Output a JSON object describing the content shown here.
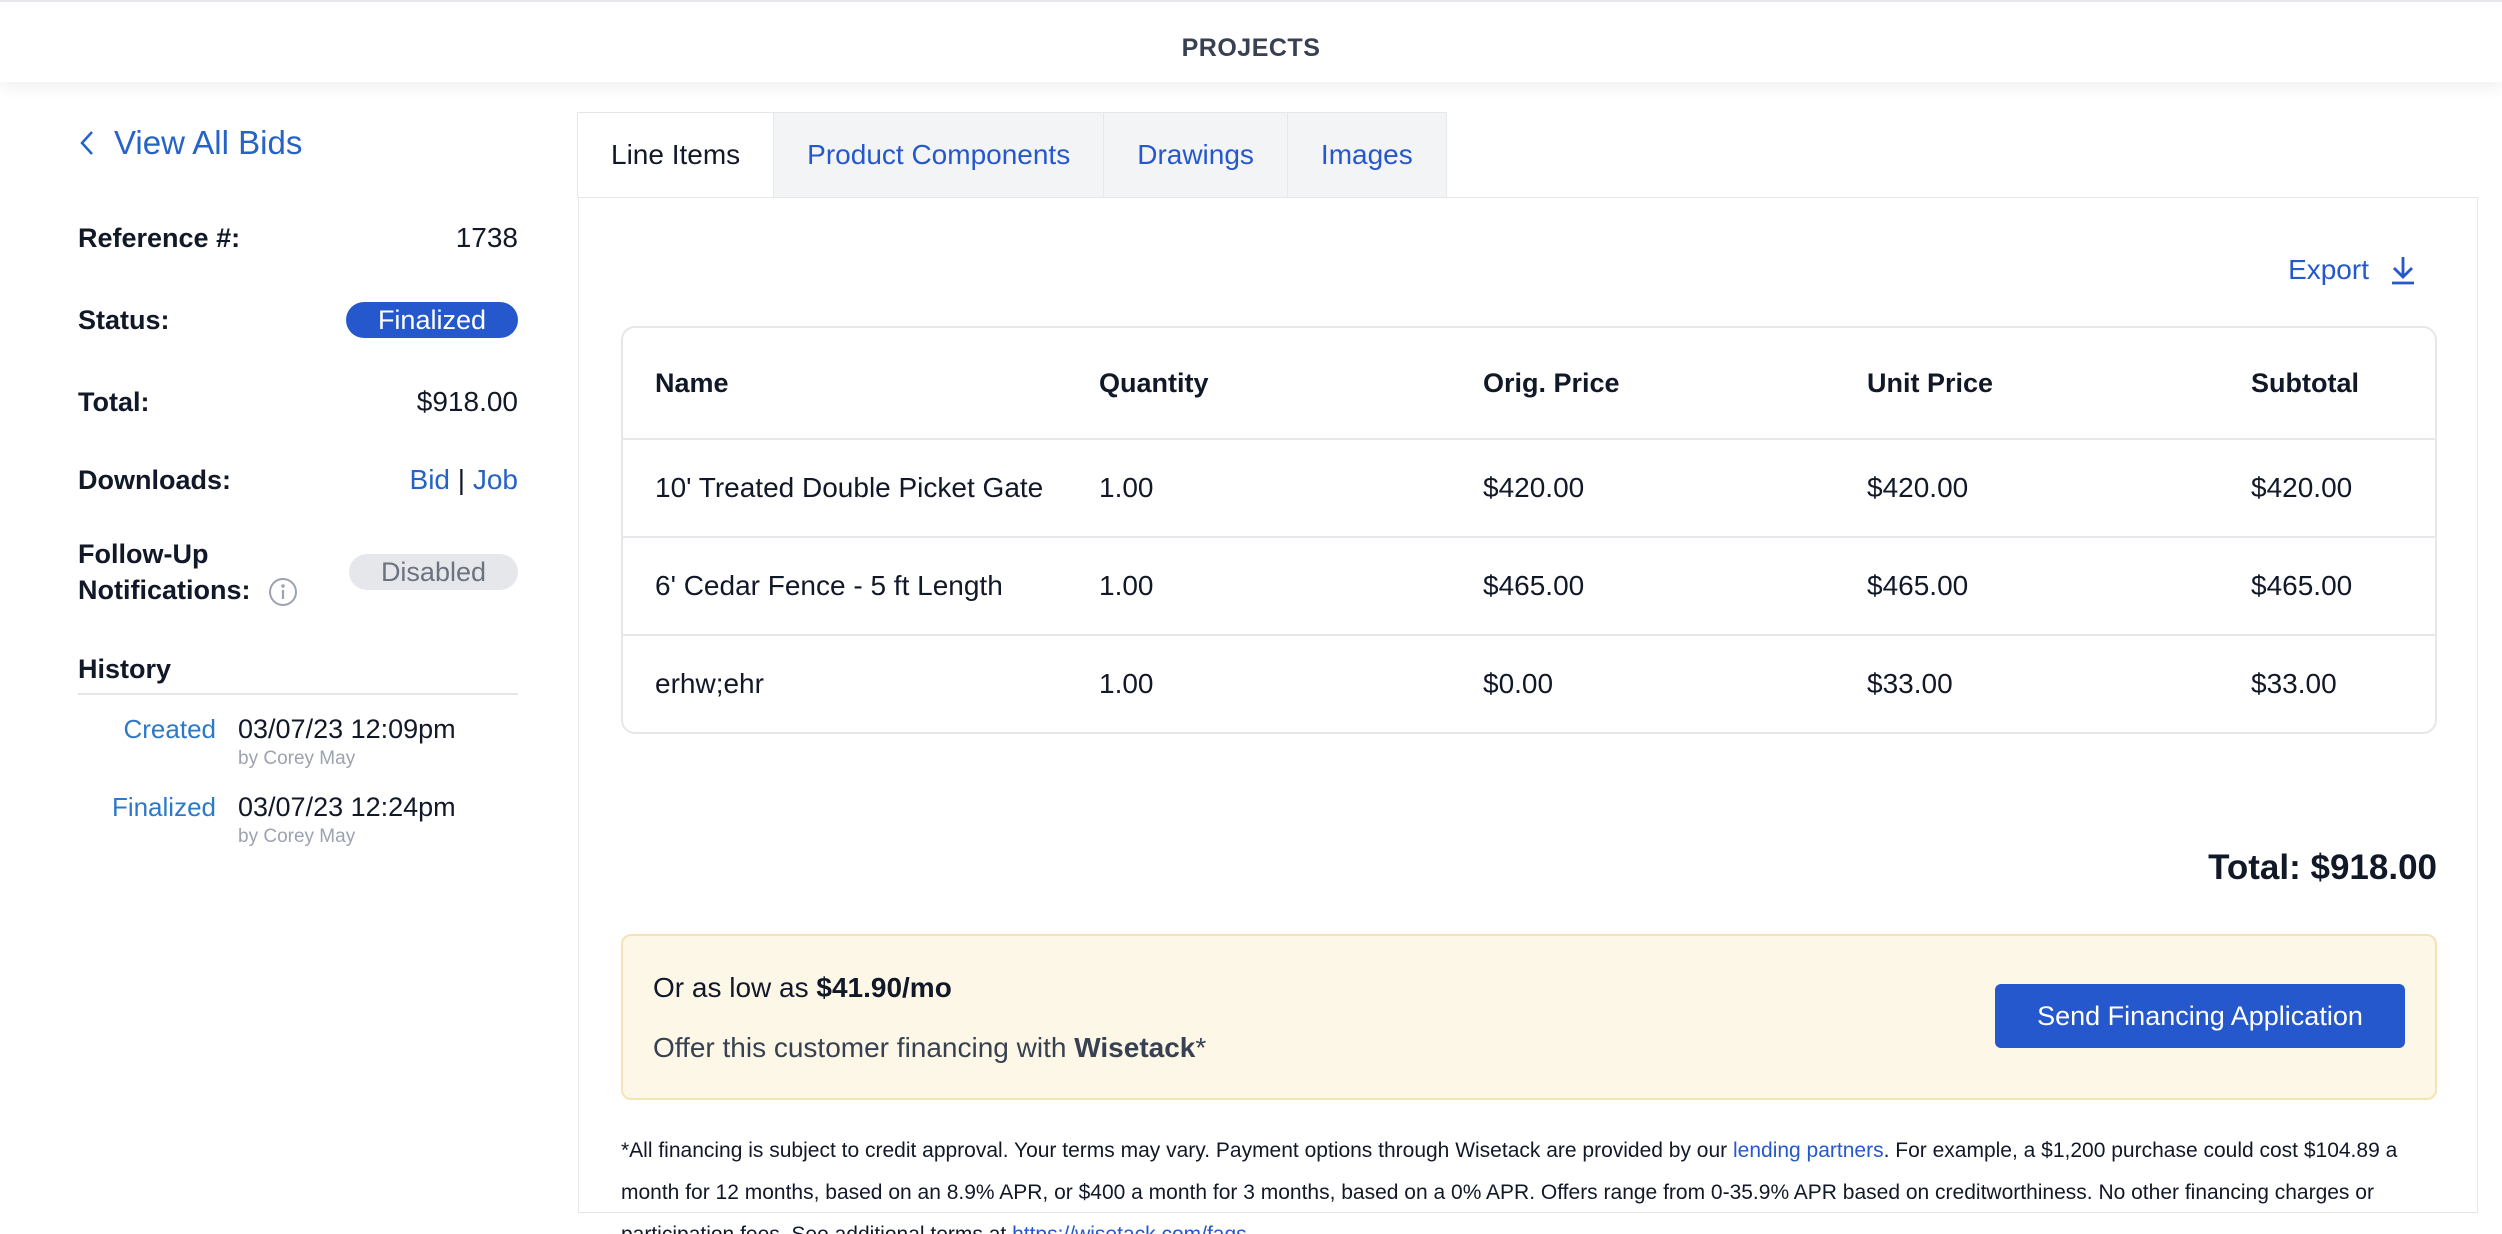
{
  "header": {
    "title": "PROJECTS"
  },
  "sidebar": {
    "back_label": "View All Bids",
    "reference_label": "Reference #:",
    "reference_value": "1738",
    "status_label": "Status:",
    "status_value": "Finalized",
    "total_label": "Total:",
    "total_value": "$918.00",
    "downloads_label": "Downloads:",
    "download_bid": "Bid",
    "download_sep": "|",
    "download_job": "Job",
    "followup_label_1": "Follow-Up",
    "followup_label_2": "Notifications:",
    "followup_value": "Disabled",
    "history_title": "History",
    "history": [
      {
        "event": "Created",
        "datetime": "03/07/23 12:09pm",
        "by": "by Corey May"
      },
      {
        "event": "Finalized",
        "datetime": "03/07/23 12:24pm",
        "by": "by Corey May"
      }
    ]
  },
  "tabs": [
    "Line Items",
    "Product Components",
    "Drawings",
    "Images"
  ],
  "export_label": "Export",
  "table": {
    "headers": [
      "Name",
      "Quantity",
      "Orig. Price",
      "Unit Price",
      "Subtotal"
    ],
    "rows": [
      [
        "10' Treated Double Picket Gate",
        "1.00",
        "$420.00",
        "$420.00",
        "$420.00"
      ],
      [
        "6' Cedar Fence - 5 ft Length",
        "1.00",
        "$465.00",
        "$465.00",
        "$465.00"
      ],
      [
        "erhw;ehr",
        "1.00",
        "$0.00",
        "$33.00",
        "$33.00"
      ]
    ]
  },
  "total_text": "Total: $918.00",
  "financing": {
    "line1_prefix": "Or as low as ",
    "line1_amount": "$41.90/mo",
    "line2_prefix": "Offer this customer financing with ",
    "line2_brand": "Wisetack",
    "line2_suffix": "*",
    "button": "Send Financing Application"
  },
  "disclaimer": {
    "part1": "*All financing is subject to credit approval. Your terms may vary. Payment options through Wisetack are provided by our ",
    "link1": "lending partners",
    "part2": ". For example, a $1,200 purchase could cost $104.89 a month for 12 months, based on an 8.9% APR, or $400 a month for 3 months, based on a 0% APR. Offers range from 0-35.9% APR based on creditworthiness. No other financing charges or participation fees. See additional terms at ",
    "link2": "https://wisetack.com/faqs"
  },
  "colors": {
    "accent": "#2558cc",
    "link": "#2563c7",
    "finance_bg": "#fdf7e8"
  },
  "icons": {
    "back": "chevron-left-icon",
    "export": "download-icon",
    "info": "info-icon"
  }
}
